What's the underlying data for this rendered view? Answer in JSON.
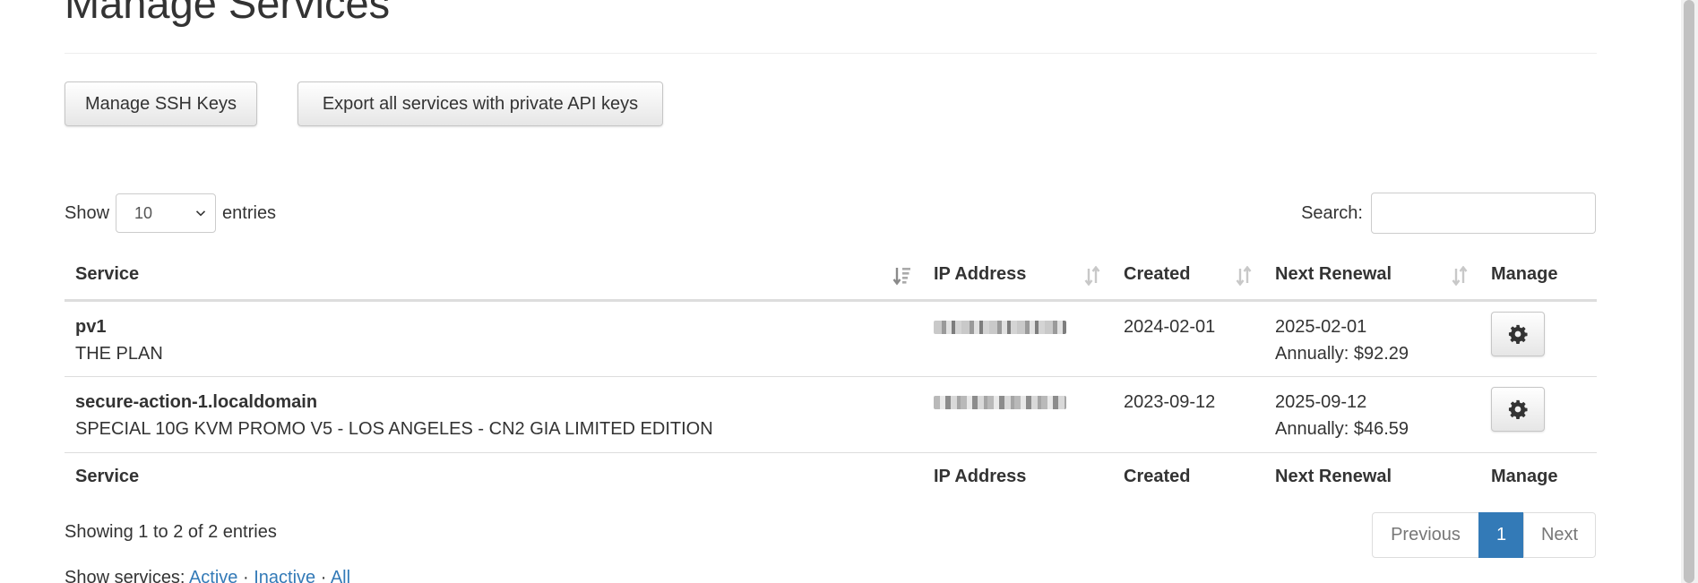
{
  "page": {
    "title": "Manage Services"
  },
  "actions": {
    "manage_ssh_keys": "Manage SSH Keys",
    "export_services": "Export all services with private API keys"
  },
  "length": {
    "show": "Show",
    "value": "10",
    "entries": "entries"
  },
  "search": {
    "label": "Search:",
    "value": ""
  },
  "table": {
    "columns": [
      "Service",
      "IP Address",
      "Created",
      "Next Renewal",
      "Manage"
    ],
    "rows": [
      {
        "name": "pv1",
        "plan": "THE PLAN",
        "created": "2024-02-01",
        "next_renewal": "2025-02-01",
        "billing": "Annually: $92.29"
      },
      {
        "name": "secure-action-1.localdomain",
        "plan": "SPECIAL 10G KVM PROMO V5 - LOS ANGELES - CN2 GIA LIMITED EDITION",
        "created": "2023-09-12",
        "next_renewal": "2025-09-12",
        "billing": "Annually: $46.59"
      }
    ]
  },
  "info": "Showing 1 to 2 of 2 entries",
  "pagination": {
    "previous": "Previous",
    "current": "1",
    "next": "Next"
  },
  "filter": {
    "label": "Show services:",
    "active": "Active",
    "separator": "·",
    "inactive": "Inactive",
    "all": "All"
  },
  "colors": {
    "link": "#337ab7",
    "current_page": "#337ab7",
    "border": "#dddddd"
  },
  "icons": {
    "manage": "gear-icon",
    "sort": "sort-icon",
    "select": "chevron-down-icon"
  }
}
